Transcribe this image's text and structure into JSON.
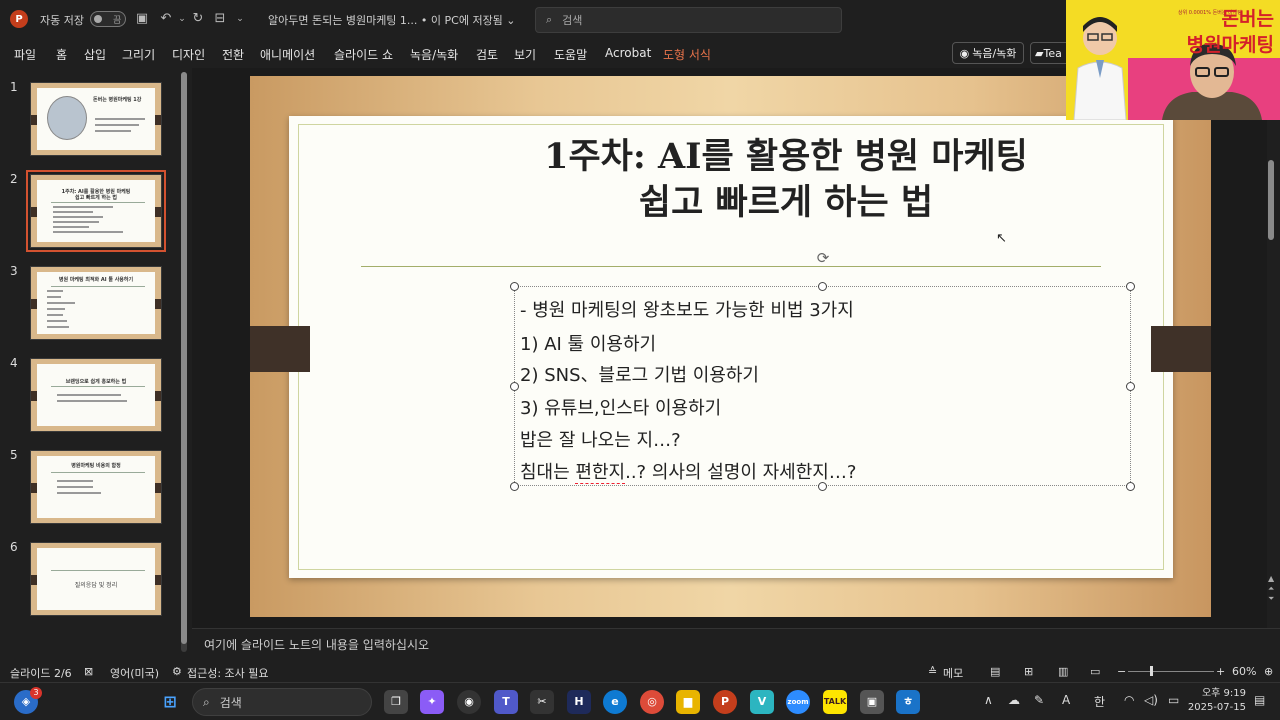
{
  "titlebar": {
    "app_icon": "powerpoint-icon",
    "autosave_label": "자동 저장",
    "autosave_state": "끔",
    "doc_title": "알아두면 돈되는 병원마케팅 1... • 이 PC에 저장됨 ⌄",
    "search_placeholder": "검색"
  },
  "menu": [
    {
      "label": "파일",
      "accent": false
    },
    {
      "label": "홈",
      "accent": false
    },
    {
      "label": "삽입",
      "accent": false
    },
    {
      "label": "그리기",
      "accent": false
    },
    {
      "label": "디자인",
      "accent": false
    },
    {
      "label": "전환",
      "accent": false
    },
    {
      "label": "애니메이션",
      "accent": false
    },
    {
      "label": "슬라이드 쇼",
      "accent": false
    },
    {
      "label": "녹음/녹화",
      "accent": false
    },
    {
      "label": "검토",
      "accent": false
    },
    {
      "label": "보기",
      "accent": false
    },
    {
      "label": "도움말",
      "accent": false
    },
    {
      "label": "Acrobat",
      "accent": false
    },
    {
      "label": "도형 서식",
      "accent": true
    }
  ],
  "ribbon_right": {
    "record_label": "녹음/녹화",
    "teams_label": "Tea"
  },
  "thumbnails": [
    {
      "number": "1",
      "line1": "돈버는 병원마케팅 1강",
      "line2": ""
    },
    {
      "number": "2",
      "line1": "1주차: AI를 활용한 병원 마케팅",
      "line2": "쉽고 빠르게 하는 법"
    },
    {
      "number": "3",
      "line1": "병원 마케팅 최적화 AI 툴 사용하기",
      "line2": ""
    },
    {
      "number": "4",
      "line1": "브랜딩으로 쉽게 홍보하는 법",
      "line2": ""
    },
    {
      "number": "5",
      "line1": "병원마케팅 비용의 함정",
      "line2": ""
    },
    {
      "number": "6",
      "line1": "",
      "line2": "",
      "center": "질의응답 및 정리"
    }
  ],
  "slide": {
    "title_line1": "1주차: AI를 활용한 병원 마케팅",
    "title_line2": "쉽고 빠르게 하는 법",
    "body": [
      "- 병원 마케팅의 왕초보도 가능한 비법 3가지",
      "1) AI 툴 이용하기",
      "2) SNS、블로그 기법 이용하기",
      "3) 유튜브,인스타 이용하기",
      "밥은 잘 나오는 지…?"
    ],
    "last_line_pre": "침대는 ",
    "last_line_err": "편한지",
    "last_line_post": "..? 의사의 설명이 자세한지…?"
  },
  "notes_placeholder": "여기에 슬라이드 노트의 내용을 입력하십시오",
  "status": {
    "slide_count": "슬라이드 2/6",
    "language": "영어(미국)",
    "accessibility": "접근성: 조사 필요",
    "notes_label": "메모",
    "zoom": "60%"
  },
  "taskbar": {
    "search_label": "검색",
    "notification_count": "3",
    "ime_lang": "A",
    "ime_mode": "한",
    "time": "오후 9:19",
    "date": "2025-07-15"
  },
  "overlay": {
    "brand_line1": "돈버는",
    "brand_line2": "병원마케팅",
    "fine_print": "상위 0.0001% 돈버는 마케팅"
  }
}
